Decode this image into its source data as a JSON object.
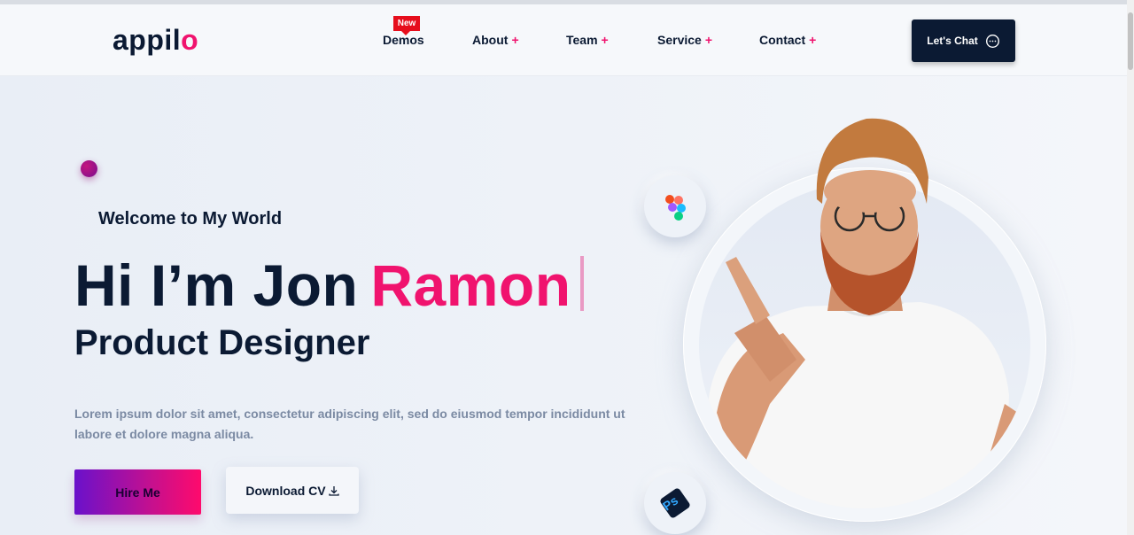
{
  "header": {
    "logo_main": "appil",
    "logo_accent": "o",
    "nav": [
      {
        "label": "Demos",
        "has_plus": false,
        "badge": "New"
      },
      {
        "label": "About",
        "plus": "+"
      },
      {
        "label": "Team",
        "plus": "+"
      },
      {
        "label": "Service",
        "plus": "+"
      },
      {
        "label": "Contact",
        "plus": "+"
      }
    ],
    "chat_label": "Let's Chat"
  },
  "hero": {
    "welcome": "Welcome to My World",
    "title_part1": "Hi I’m Jon",
    "title_part2": "Ramon",
    "subtitle": "Product Designer",
    "description": "Lorem ipsum dolor sit amet, consectetur adipiscing elit, sed do eiusmod tempor incididunt ut labore et dolore magna aliqua.",
    "hire_label": "Hire Me",
    "cv_label": "Download CV"
  },
  "icons": {
    "figma": "figma-icon",
    "photoshop": "photoshop-icon",
    "photoshop_text": "Ps",
    "chat": "chat-bubble-icon",
    "download": "download-icon"
  },
  "colors": {
    "accent": "#f0136e",
    "dark": "#0b1a33",
    "muted": "#7b8aa3",
    "badge": "#e60e1c"
  }
}
